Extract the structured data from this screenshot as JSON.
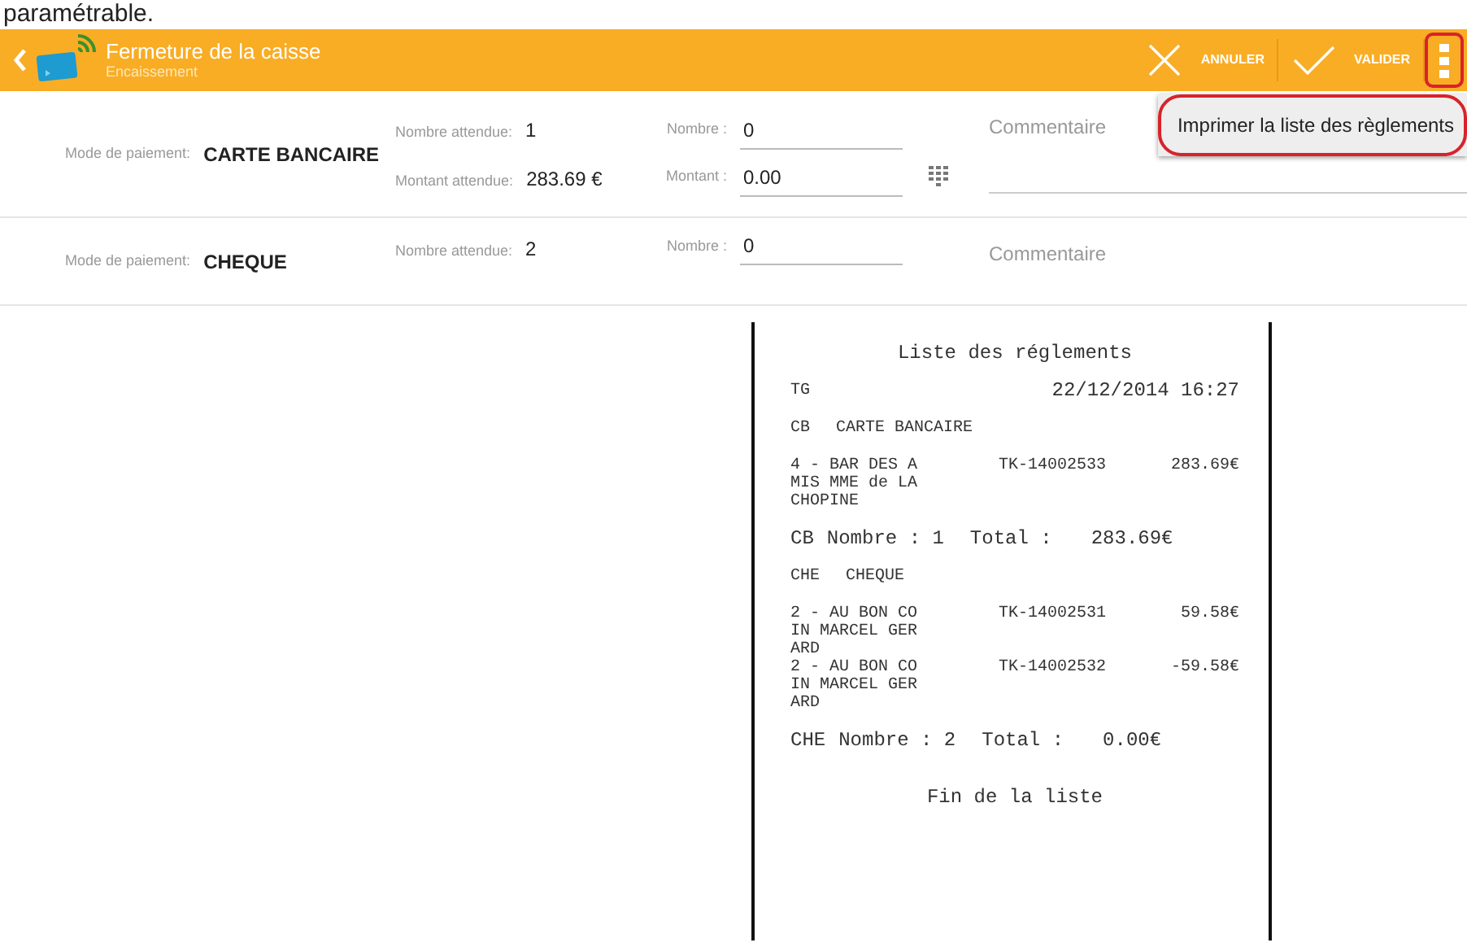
{
  "caption": "paramétrable.",
  "header": {
    "title": "Fermeture de la caisse",
    "subtitle": "Encaissement",
    "actions": [
      {
        "kind": "cancel",
        "label": "ANNULER"
      },
      {
        "kind": "confirm",
        "label": "VALIDER"
      }
    ],
    "overflow_highlighted": true
  },
  "menu": {
    "items": [
      {
        "label": "Imprimer la liste des règlements",
        "highlighted": true
      }
    ]
  },
  "payments": [
    {
      "mode_label": "Mode de paiement:",
      "mode": "CARTE BANCAIRE",
      "expected": [
        {
          "label": "Nombre attendue:",
          "value": "1"
        },
        {
          "label": "Montant attendue:",
          "value": "283.69 €"
        }
      ],
      "fields": [
        {
          "label": "Nombre :",
          "value": "0",
          "keypad": false
        },
        {
          "label": "Montant :",
          "value": "0.00",
          "keypad": true
        }
      ],
      "comment_placeholder": "Commentaire"
    },
    {
      "mode_label": "Mode de paiement:",
      "mode": "CHEQUE",
      "expected": [
        {
          "label": "Nombre attendue:",
          "value": "2"
        }
      ],
      "fields": [
        {
          "label": "Nombre :",
          "value": "0",
          "keypad": false
        }
      ],
      "comment_placeholder": "Commentaire"
    }
  ],
  "receipt": {
    "title": "Liste des réglements",
    "terminal": "TG",
    "datetime": "22/12/2014 16:27",
    "groups": [
      {
        "code": "CB",
        "name": "CARTE BANCAIRE",
        "lines": [
          {
            "client": "4 - BAR DES A\nMIS MME de LA\nCHOPINE",
            "ticket": "TK-14002533",
            "amount": "283.69€"
          }
        ],
        "summary": {
          "code": "CB",
          "count": "Nombre : 1",
          "total_label": "Total :",
          "total": "283.69€"
        }
      },
      {
        "code": "CHE",
        "name": "CHEQUE",
        "lines": [
          {
            "client": "2 - AU BON CO\nIN MARCEL GER\nARD",
            "ticket": "TK-14002531",
            "amount": "59.58€"
          },
          {
            "client": "2 - AU BON CO\nIN MARCEL GER\nARD",
            "ticket": "TK-14002532",
            "amount": "-59.58€"
          }
        ],
        "summary": {
          "code": "CHE",
          "count": "Nombre : 2",
          "total_label": "Total :",
          "total": "0.00€"
        }
      }
    ],
    "footer": "Fin de la liste"
  }
}
